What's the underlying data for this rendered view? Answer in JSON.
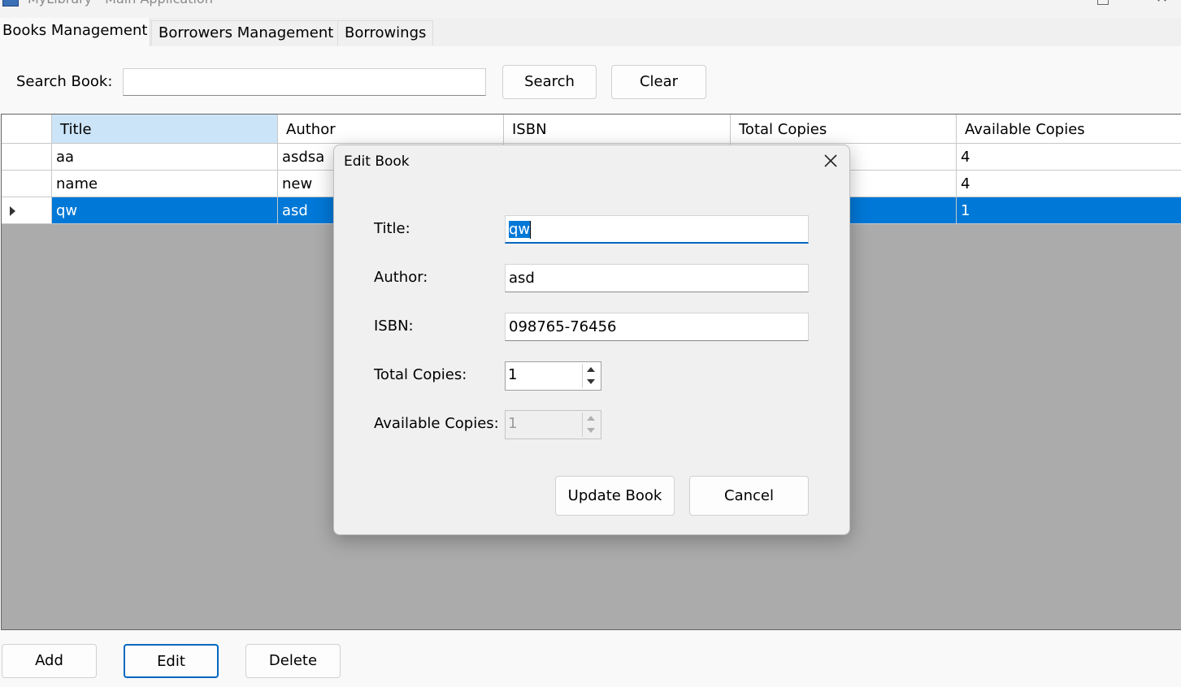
{
  "window": {
    "title": "MyLibrary - Main Application"
  },
  "tabs": [
    {
      "label": "Books Management"
    },
    {
      "label": "Borrowers Management"
    },
    {
      "label": "Borrowings"
    }
  ],
  "search": {
    "label": "Search Book:",
    "value": "",
    "search_button": "Search",
    "clear_button": "Clear"
  },
  "grid": {
    "columns": [
      "Title",
      "Author",
      "ISBN",
      "Total Copies",
      "Available Copies"
    ],
    "rows": [
      {
        "title": "aa",
        "author": "asdsa",
        "available": "4"
      },
      {
        "title": "name",
        "author": "new",
        "available": "4"
      },
      {
        "title": "qw",
        "author": "asd",
        "available": "1"
      }
    ],
    "selected_row": 2
  },
  "actions": {
    "add": "Add",
    "edit": "Edit",
    "delete": "Delete"
  },
  "dialog": {
    "title": "Edit Book",
    "fields": {
      "title_label": "Title:",
      "title_value": "qw",
      "author_label": "Author:",
      "author_value": "asd",
      "isbn_label": "ISBN:",
      "isbn_value": "098765-76456",
      "total_label": "Total Copies:",
      "total_value": "1",
      "available_label": "Available Copies:",
      "available_value": "1"
    },
    "update_button": "Update Book",
    "cancel_button": "Cancel"
  },
  "colors": {
    "selection": "#0078d7",
    "accent": "#0067c0",
    "header_selected": "#cce4f7"
  }
}
